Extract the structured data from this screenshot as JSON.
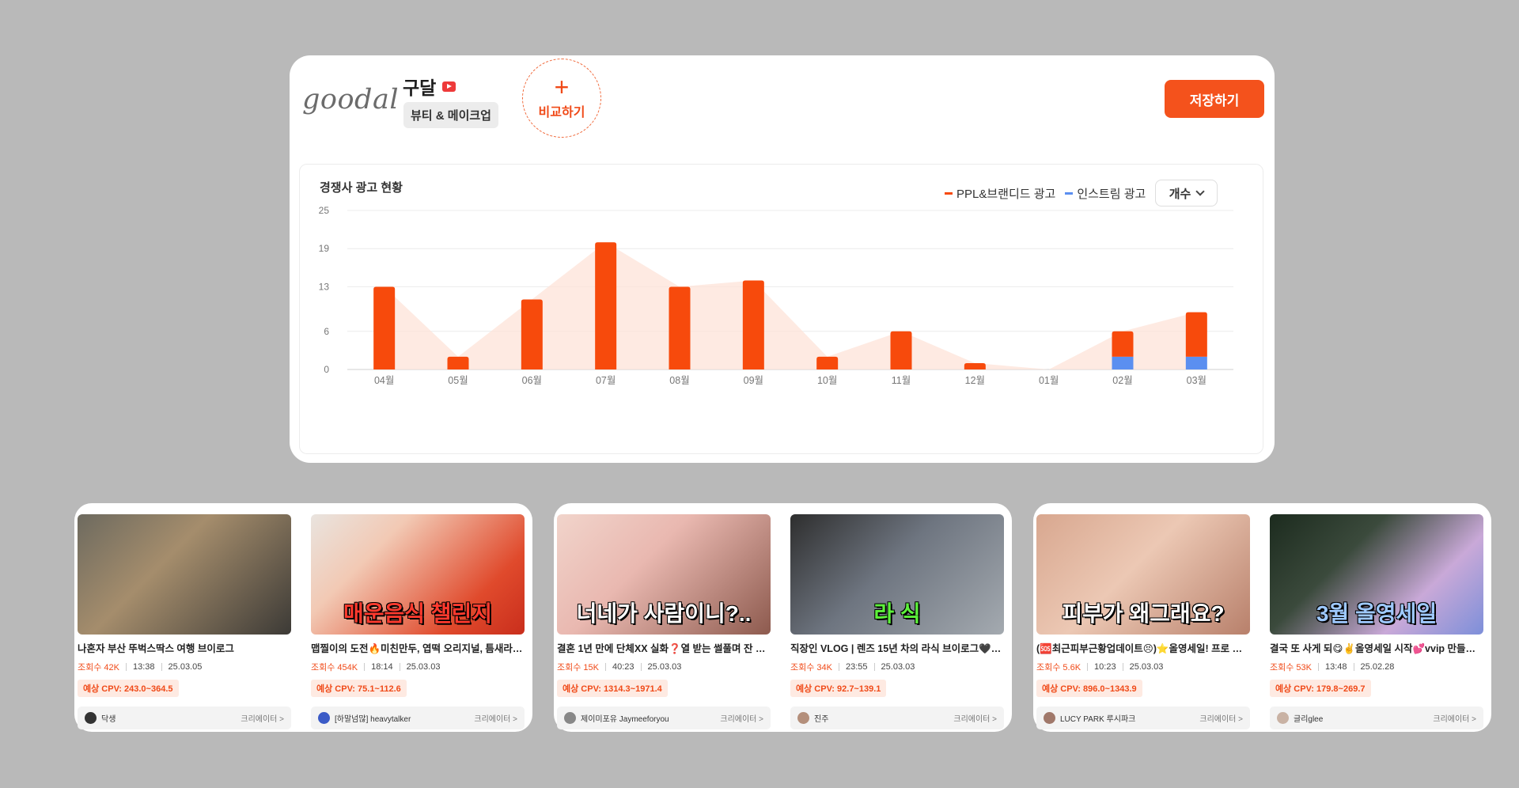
{
  "brand": {
    "logo_text": "goodal",
    "name": "구달",
    "category": "뷰티 & 메이크업",
    "compare_label": "비교하기",
    "save_label": "저장하기"
  },
  "chart": {
    "title": "경쟁사 광고 현황",
    "select_label": "개수",
    "colors": {
      "ppl": "#f74a0c",
      "instream": "#5b8ff0",
      "area": "#fde3d8"
    }
  },
  "chart_data": {
    "type": "bar",
    "stacked": true,
    "categories": [
      "04월",
      "05월",
      "06월",
      "07월",
      "08월",
      "09월",
      "10월",
      "11월",
      "12월",
      "01월",
      "02월",
      "03월"
    ],
    "series": [
      {
        "name": "PPL&브랜디드 광고",
        "values": [
          13,
          2,
          11,
          20,
          13,
          14,
          2,
          6,
          1,
          0,
          4,
          7
        ]
      },
      {
        "name": "인스트림 광고",
        "values": [
          0,
          0,
          0,
          0,
          0,
          0,
          0,
          0,
          0,
          0,
          2,
          2
        ]
      }
    ],
    "yticks": [
      0,
      6,
      13,
      19,
      25
    ],
    "ylim": [
      0,
      25
    ],
    "grid": true,
    "legend": "top-right"
  },
  "video_groups": [
    {
      "videos": [
        {
          "title": "나혼자 부산 뚜벅스딱스 여행 브이로그",
          "views_label": "조회수 42K",
          "duration": "13:38",
          "date": "25.03.05",
          "cpv": "예상 CPV: 243.0~364.5",
          "creator": "닥생",
          "creator_link": "크리에이터 >",
          "thumb_text": ""
        },
        {
          "title": "맵찔이의 도전🔥미친만두, 엽떡 오리지널, 틈새라면 빨...",
          "views_label": "조회수 454K",
          "duration": "18:14",
          "date": "25.03.03",
          "cpv": "예상 CPV: 75.1~112.6",
          "creator": "[하말넘많] heavytalker",
          "creator_link": "크리에이터 >",
          "thumb_text": "매운음식 챌린지"
        }
      ]
    },
    {
      "videos": [
        {
          "title": "결혼 1년 만에 단체XX 실화❓열 받는 썰풀며 잔 준비하...",
          "views_label": "조회수 15K",
          "duration": "40:23",
          "date": "25.03.03",
          "cpv": "예상 CPV: 1314.3~1971.4",
          "creator": "제이미포유 Jaymeeforyou",
          "creator_link": "크리에이터 >",
          "thumb_text": "너네가 사람이니?.."
        },
        {
          "title": "직장인 VLOG | 렌즈 15년 차의 라식 브이로그🖤🖤 | 수...",
          "views_label": "조회수 34K",
          "duration": "23:55",
          "date": "25.03.03",
          "cpv": "예상 CPV: 92.7~139.1",
          "creator": "진주",
          "creator_link": "크리에이터 >",
          "thumb_text": "라  식"
        }
      ]
    },
    {
      "videos": [
        {
          "title": "(🆘최근피부근황업데이트😣)⭐올영세일! 프로 민감...",
          "views_label": "조회수 5.6K",
          "duration": "10:23",
          "date": "25.03.03",
          "cpv": "예상 CPV: 896.0~1343.9",
          "creator": "LUCY PARK 루시파크",
          "creator_link": "크리에이터 >",
          "thumb_text": "피부가 왜그래요?"
        },
        {
          "title": "결국 또 사게 되😋✌️올영세일 시작💕vvip 만들어준 ...",
          "views_label": "조회수 53K",
          "duration": "13:48",
          "date": "25.02.28",
          "cpv": "예상 CPV: 179.8~269.7",
          "creator": "글리glee",
          "creator_link": "크리에이터 >",
          "thumb_text": "3월 올영세일"
        }
      ]
    }
  ]
}
